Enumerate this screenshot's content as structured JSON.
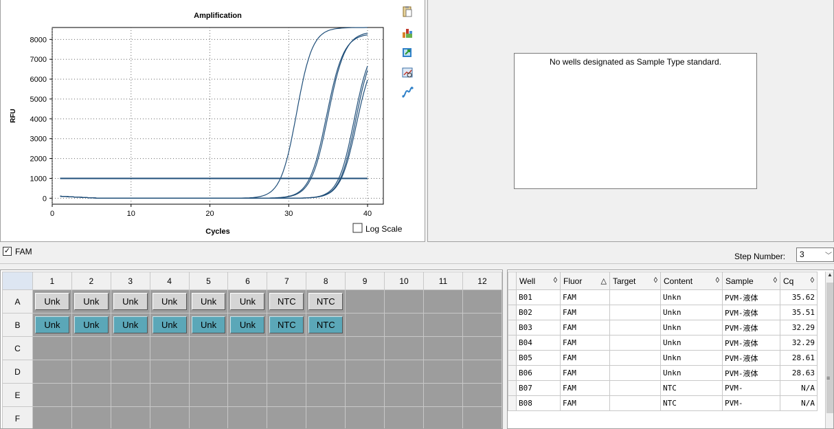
{
  "chart_data": {
    "type": "line",
    "title": "Amplification",
    "xlabel": "Cycles",
    "ylabel": "RFU",
    "xlim": [
      0,
      42
    ],
    "ylim": [
      -300,
      8600
    ],
    "xticks": [
      0,
      10,
      20,
      30,
      40
    ],
    "yticks": [
      0,
      1000,
      2000,
      3000,
      4000,
      5000,
      6000,
      7000,
      8000
    ],
    "threshold": 1000,
    "x_range": [
      1,
      40
    ],
    "series": [
      {
        "values_note": "",
        "midpoint": 31.0,
        "max": 8600,
        "slope": 0.45
      },
      {
        "midpoint": 34.8,
        "max": 8300,
        "slope": 0.42
      },
      {
        "midpoint": 35.0,
        "max": 8400,
        "slope": 0.42
      },
      {
        "midpoint": 38.3,
        "max": 7900,
        "slope": 0.45
      },
      {
        "midpoint": 38.5,
        "max": 7900,
        "slope": 0.45
      },
      {
        "midpoint": 38.6,
        "max": 7500,
        "slope": 0.44
      }
    ],
    "log_scale_label": "Log Scale",
    "line_color": "#1f4e79"
  },
  "standard_curve": {
    "message": "No wells designated as Sample Type standard."
  },
  "fluor_bar": {
    "fam_label": "FAM",
    "step_label": "Step Number:",
    "step_value": "3"
  },
  "plate": {
    "columns": [
      "1",
      "2",
      "3",
      "4",
      "5",
      "6",
      "7",
      "8",
      "9",
      "10",
      "11",
      "12"
    ],
    "rows": [
      {
        "label": "A",
        "wells": [
          "Unk",
          "Unk",
          "Unk",
          "Unk",
          "Unk",
          "Unk",
          "NTC",
          "NTC",
          "",
          "",
          "",
          ""
        ],
        "style": "gray"
      },
      {
        "label": "B",
        "wells": [
          "Unk",
          "Unk",
          "Unk",
          "Unk",
          "Unk",
          "Unk",
          "NTC",
          "NTC",
          "",
          "",
          "",
          ""
        ],
        "style": "teal"
      },
      {
        "label": "C",
        "wells": [
          "",
          "",
          "",
          "",
          "",
          "",
          "",
          "",
          "",
          "",
          "",
          ""
        ],
        "style": ""
      },
      {
        "label": "D",
        "wells": [
          "",
          "",
          "",
          "",
          "",
          "",
          "",
          "",
          "",
          "",
          "",
          ""
        ],
        "style": ""
      },
      {
        "label": "E",
        "wells": [
          "",
          "",
          "",
          "",
          "",
          "",
          "",
          "",
          "",
          "",
          "",
          ""
        ],
        "style": ""
      },
      {
        "label": "F",
        "wells": [
          "",
          "",
          "",
          "",
          "",
          "",
          "",
          "",
          "",
          "",
          "",
          ""
        ],
        "style": ""
      }
    ]
  },
  "results": {
    "headers": [
      {
        "label": "Well",
        "sort": "◊"
      },
      {
        "label": "Fluor",
        "sort": "△"
      },
      {
        "label": "Target",
        "sort": "◊"
      },
      {
        "label": "Content",
        "sort": "◊"
      },
      {
        "label": "Sample",
        "sort": "◊"
      },
      {
        "label": "Cq",
        "sort": "◊"
      }
    ],
    "rows": [
      [
        "B01",
        "FAM",
        "",
        "Unkn",
        "PVM-液体",
        "35.62"
      ],
      [
        "B02",
        "FAM",
        "",
        "Unkn",
        "PVM-液体",
        "35.51"
      ],
      [
        "B03",
        "FAM",
        "",
        "Unkn",
        "PVM-液体",
        "32.29"
      ],
      [
        "B04",
        "FAM",
        "",
        "Unkn",
        "PVM-液体",
        "32.29"
      ],
      [
        "B05",
        "FAM",
        "",
        "Unkn",
        "PVM-液体",
        "28.61"
      ],
      [
        "B06",
        "FAM",
        "",
        "Unkn",
        "PVM-液体",
        "28.63"
      ],
      [
        "B07",
        "FAM",
        "",
        "NTC",
        "PVM-",
        "N/A"
      ],
      [
        "B08",
        "FAM",
        "",
        "NTC",
        "PVM-",
        "N/A"
      ]
    ]
  },
  "icons": [
    "clipboard-icon",
    "bar-chart-icon",
    "export-icon",
    "zoom-chart-icon",
    "curve-icon"
  ]
}
